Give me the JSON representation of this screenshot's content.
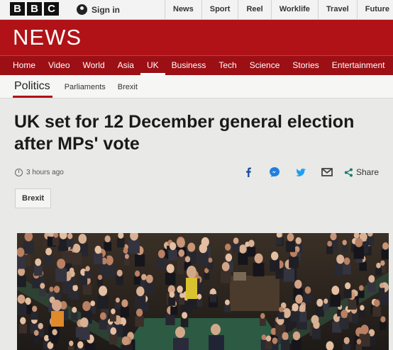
{
  "header": {
    "logo_letters": [
      "B",
      "B",
      "C"
    ],
    "sign_in": "Sign in",
    "links": [
      "News",
      "Sport",
      "Reel",
      "Worklife",
      "Travel",
      "Future"
    ]
  },
  "banner": {
    "title": "NEWS"
  },
  "nav": {
    "items": [
      "Home",
      "Video",
      "World",
      "Asia",
      "UK",
      "Business",
      "Tech",
      "Science",
      "Stories",
      "Entertainment"
    ],
    "active": "UK"
  },
  "subnav": {
    "section": "Politics",
    "links": [
      "Parliaments",
      "Brexit"
    ]
  },
  "article": {
    "headline": "UK set for 12 December general election after MPs' vote",
    "timestamp": "3 hours ago",
    "share_label": "Share",
    "share_icons": [
      "facebook-icon",
      "messenger-icon",
      "twitter-icon",
      "email-icon",
      "share-icon"
    ],
    "tag": "Brexit"
  },
  "colors": {
    "brand_red": "#b01217",
    "nav_red": "#9c0f14",
    "facebook": "#1c4fa0",
    "messenger": "#1f7fe0",
    "twitter": "#1da1f2"
  }
}
